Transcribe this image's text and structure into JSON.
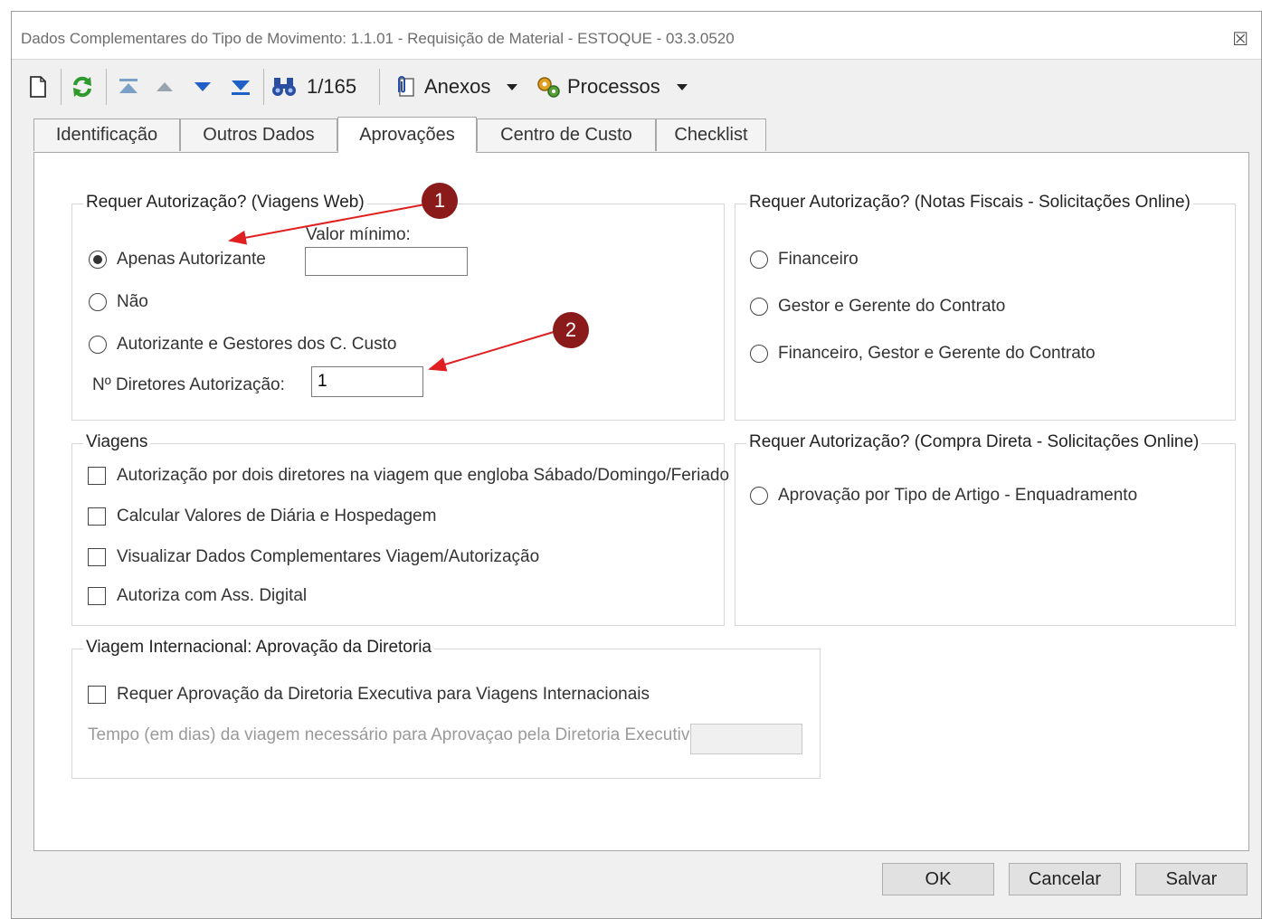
{
  "window": {
    "title": "Dados Complementares do Tipo de Movimento: 1.1.01 - Requisição de Material - ESTOQUE - 03.3.0520",
    "close_glyph": "☒"
  },
  "toolbar": {
    "record_counter": "1/165",
    "anexos_label": "Anexos",
    "processos_label": "Processos"
  },
  "tabs": [
    {
      "label": "Identificação"
    },
    {
      "label": "Outros Dados"
    },
    {
      "label": "Aprovações"
    },
    {
      "label": "Centro de Custo"
    },
    {
      "label": "Checklist"
    }
  ],
  "viagens_web": {
    "legend": "Requer Autorização? (Viagens Web)",
    "valor_minimo_label": "Valor mínimo:",
    "valor_minimo_value": "",
    "options": [
      {
        "label": "Apenas Autorizante"
      },
      {
        "label": "Não"
      },
      {
        "label": "Autorizante e Gestores dos C. Custo"
      }
    ],
    "diretores_label": "Nº Diretores Autorização:",
    "diretores_value": "1"
  },
  "notas_fiscais": {
    "legend": "Requer Autorização? (Notas Fiscais - Solicitações Online)",
    "options": [
      {
        "label": "Financeiro"
      },
      {
        "label": "Gestor e Gerente do Contrato"
      },
      {
        "label": "Financeiro, Gestor e Gerente do Contrato"
      }
    ]
  },
  "viagens": {
    "legend": "Viagens",
    "options": [
      {
        "label": "Autorização por dois diretores na viagem que engloba Sábado/Domingo/Feriado"
      },
      {
        "label": "Calcular Valores de Diária e Hospedagem"
      },
      {
        "label": "Visualizar Dados Complementares Viagem/Autorização"
      },
      {
        "label": "Autoriza com Ass. Digital"
      }
    ]
  },
  "compra_direta": {
    "legend": "Requer Autorização? (Compra Direta - Solicitações Online)",
    "options": [
      {
        "label": "Aprovação por Tipo de Artigo - Enquadramento"
      }
    ]
  },
  "internacional": {
    "legend": "Viagem Internacional: Aprovação da Diretoria",
    "checkbox_label": "Requer Aprovação da Diretoria Executiva para Viagens Internacionais",
    "tempo_label": "Tempo (em dias) da viagem necessário para Aprovaçao pela Diretoria Executiva:",
    "tempo_value": ""
  },
  "buttons": {
    "ok": "OK",
    "cancelar": "Cancelar",
    "salvar": "Salvar"
  },
  "annotations": {
    "badge1": "1",
    "badge2": "2",
    "color": "#8b1a1a",
    "arrow_color": "#e02020"
  }
}
